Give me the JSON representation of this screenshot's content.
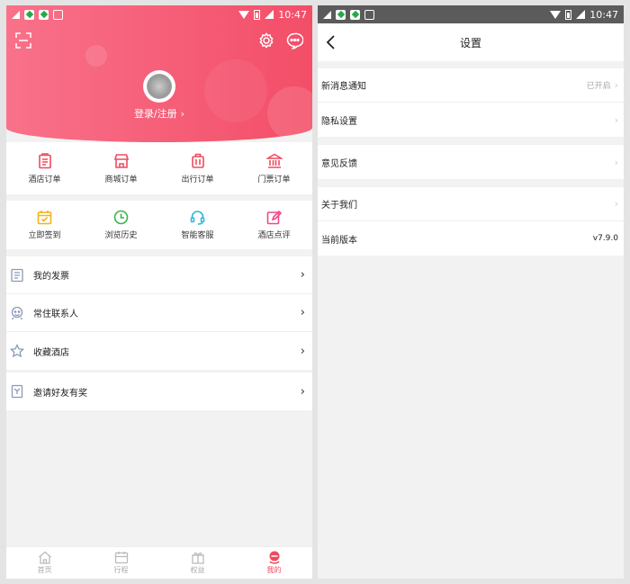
{
  "left": {
    "status": {
      "time": "10:47"
    },
    "header": {
      "login_label": "登录/注册"
    },
    "orders": [
      {
        "label": "酒店订单",
        "icon": "clipboard-icon"
      },
      {
        "label": "商城订单",
        "icon": "shop-icon"
      },
      {
        "label": "出行订单",
        "icon": "luggage-icon"
      },
      {
        "label": "门票订单",
        "icon": "temple-icon"
      }
    ],
    "tools": [
      {
        "label": "立即签到",
        "icon": "calendar-check-icon"
      },
      {
        "label": "浏览历史",
        "icon": "clock-icon"
      },
      {
        "label": "智能客服",
        "icon": "headset-icon"
      },
      {
        "label": "酒店点评",
        "icon": "edit-icon"
      }
    ],
    "list": [
      {
        "label": "我的发票",
        "icon": "invoice-icon"
      },
      {
        "label": "常住联系人",
        "icon": "contact-icon"
      },
      {
        "label": "收藏酒店",
        "icon": "star-icon"
      }
    ],
    "invite": {
      "label": "邀请好友有奖",
      "icon": "gift-icon"
    },
    "tabbar": [
      {
        "label": "首页",
        "icon": "home-icon"
      },
      {
        "label": "行程",
        "icon": "itinerary-icon"
      },
      {
        "label": "权益",
        "icon": "benefit-icon"
      },
      {
        "label": "我的",
        "icon": "profile-icon",
        "active": true
      }
    ]
  },
  "right": {
    "status": {
      "time": "10:47"
    },
    "nav": {
      "title": "设置"
    },
    "group1": [
      {
        "label": "新消息通知",
        "value": "已开启"
      },
      {
        "label": "隐私设置",
        "value": ""
      }
    ],
    "group2": [
      {
        "label": "意见反馈",
        "value": ""
      }
    ],
    "group3": [
      {
        "label": "关于我们",
        "value": ""
      },
      {
        "label": "当前版本",
        "value": "v7.9.0"
      }
    ]
  },
  "colors": {
    "accent": "#f04a5f",
    "hero_start": "#f9718a",
    "hero_end": "#f34e68"
  }
}
